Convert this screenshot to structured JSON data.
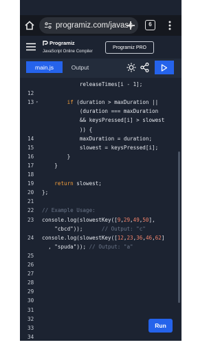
{
  "browser": {
    "url": "programiz.com/javasc",
    "tab_count": "6"
  },
  "header": {
    "logo": "Programiz",
    "subtitle": "JavaScript Online Compiler",
    "pro_label": "Programiz PRO"
  },
  "toolbar": {
    "tab_main": "main.js",
    "tab_output": "Output",
    "run_label": "Run"
  },
  "code_lines": [
    {
      "n": "",
      "fold": "",
      "tokens": [
        {
          "t": "t",
          "v": "            releaseTimes[i - 1];"
        }
      ]
    },
    {
      "n": "12",
      "fold": "",
      "tokens": []
    },
    {
      "n": "13",
      "fold": "▾",
      "tokens": [
        {
          "t": "t",
          "v": "        "
        },
        {
          "t": "k",
          "v": "if"
        },
        {
          "t": "t",
          "v": " (duration > maxDuration ||"
        }
      ]
    },
    {
      "n": "",
      "fold": "",
      "tokens": [
        {
          "t": "t",
          "v": "            (duration === maxDuration"
        }
      ]
    },
    {
      "n": "",
      "fold": "",
      "tokens": [
        {
          "t": "t",
          "v": "            && keysPressed[i] > slowest"
        }
      ]
    },
    {
      "n": "",
      "fold": "",
      "tokens": [
        {
          "t": "t",
          "v": "            )) {"
        }
      ]
    },
    {
      "n": "14",
      "fold": "",
      "tokens": [
        {
          "t": "t",
          "v": "            maxDuration = duration;"
        }
      ]
    },
    {
      "n": "15",
      "fold": "",
      "tokens": [
        {
          "t": "t",
          "v": "            slowest = keysPressed[i];"
        }
      ]
    },
    {
      "n": "16",
      "fold": "",
      "tokens": [
        {
          "t": "t",
          "v": "        }"
        }
      ]
    },
    {
      "n": "17",
      "fold": "",
      "tokens": [
        {
          "t": "t",
          "v": "    }"
        }
      ]
    },
    {
      "n": "18",
      "fold": "",
      "tokens": []
    },
    {
      "n": "19",
      "fold": "",
      "tokens": [
        {
          "t": "t",
          "v": "    "
        },
        {
          "t": "k",
          "v": "return"
        },
        {
          "t": "t",
          "v": " slowest;"
        }
      ]
    },
    {
      "n": "20",
      "fold": "",
      "tokens": [
        {
          "t": "t",
          "v": "};"
        }
      ]
    },
    {
      "n": "21",
      "fold": "",
      "tokens": []
    },
    {
      "n": "22",
      "fold": "",
      "tokens": [
        {
          "t": "c",
          "v": "// Example Usage:"
        }
      ]
    },
    {
      "n": "23",
      "fold": "",
      "tokens": [
        {
          "t": "t",
          "v": "console.log(slowestKey(["
        },
        {
          "t": "n",
          "v": "9"
        },
        {
          "t": "t",
          "v": ","
        },
        {
          "t": "n",
          "v": "29"
        },
        {
          "t": "t",
          "v": ","
        },
        {
          "t": "n",
          "v": "49"
        },
        {
          "t": "t",
          "v": ","
        },
        {
          "t": "n",
          "v": "50"
        },
        {
          "t": "t",
          "v": "],"
        }
      ]
    },
    {
      "n": "",
      "fold": "",
      "tokens": [
        {
          "t": "s",
          "v": "    \"cbcd\""
        },
        {
          "t": "t",
          "v": "));      "
        },
        {
          "t": "c",
          "v": "// Output: \"c\""
        }
      ]
    },
    {
      "n": "24",
      "fold": "",
      "tokens": [
        {
          "t": "t",
          "v": "console.log(slowestKey(["
        },
        {
          "t": "n",
          "v": "12"
        },
        {
          "t": "t",
          "v": ","
        },
        {
          "t": "n",
          "v": "23"
        },
        {
          "t": "t",
          "v": ","
        },
        {
          "t": "n",
          "v": "36"
        },
        {
          "t": "t",
          "v": ","
        },
        {
          "t": "n",
          "v": "46"
        },
        {
          "t": "t",
          "v": ","
        },
        {
          "t": "n",
          "v": "62"
        },
        {
          "t": "t",
          "v": "]"
        }
      ]
    },
    {
      "n": "",
      "fold": "",
      "tokens": [
        {
          "t": "t",
          "v": "  , "
        },
        {
          "t": "s",
          "v": "\"spuda\""
        },
        {
          "t": "t",
          "v": ")); "
        },
        {
          "t": "c",
          "v": "// Output: \"a\""
        }
      ]
    },
    {
      "n": "25",
      "fold": "",
      "tokens": []
    },
    {
      "n": "26",
      "fold": "",
      "tokens": []
    },
    {
      "n": "27",
      "fold": "",
      "tokens": []
    },
    {
      "n": "28",
      "fold": "",
      "tokens": []
    },
    {
      "n": "29",
      "fold": "",
      "tokens": []
    },
    {
      "n": "30",
      "fold": "",
      "tokens": []
    },
    {
      "n": "31",
      "fold": "",
      "tokens": []
    },
    {
      "n": "32",
      "fold": "",
      "tokens": []
    },
    {
      "n": "33",
      "fold": "",
      "tokens": []
    },
    {
      "n": "34",
      "fold": "",
      "tokens": []
    }
  ],
  "colors": {
    "accent": "#2563eb",
    "background": "#1c2331",
    "keyword": "#f59f3b",
    "number": "#f0826a",
    "comment": "#6b7689"
  }
}
